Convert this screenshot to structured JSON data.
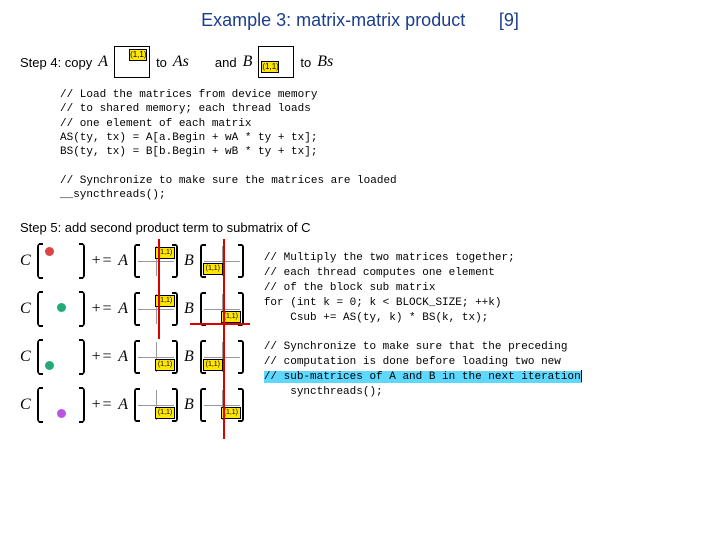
{
  "title": "Example 3: matrix-matrix product",
  "ref": "[9]",
  "step4_label": "Step 4: copy",
  "step4_to1": "to",
  "step4_and": "and",
  "step4_to2": "to",
  "vars": {
    "A": "A",
    "As": "As",
    "B": "B",
    "Bs": "Bs",
    "C": "C",
    "pluseq": "+="
  },
  "cell_label": "(1,1)",
  "code1": "// Load the matrices from device memory\n// to shared memory; each thread loads\n// one element of each matrix\nAS(ty, tx) = A[a.Begin + wA * ty + tx];\nBS(ty, tx) = B[b.Begin + wB * ty + tx];\n\n// Synchronize to make sure the matrices are loaded\n__syncthreads();",
  "step5_label": "Step 5: add second product term to submatrix of C",
  "code2_pre": "// Multiply the two matrices together;\n// each thread computes one element\n// of the block sub matrix\nfor (int k = 0; k < BLOCK_SIZE; ++k)\n    Csub += AS(ty, k) * BS(k, tx);\n\n// Synchronize to make sure that the preceding\n// computation is done before loading two new\n",
  "code2_hl": "// sub-matrices of A and B in the next iteration",
  "code2_post": "    syncthreads();",
  "dot_colors": [
    "#d44",
    "#2a7",
    "#2a7",
    "#b5d"
  ]
}
